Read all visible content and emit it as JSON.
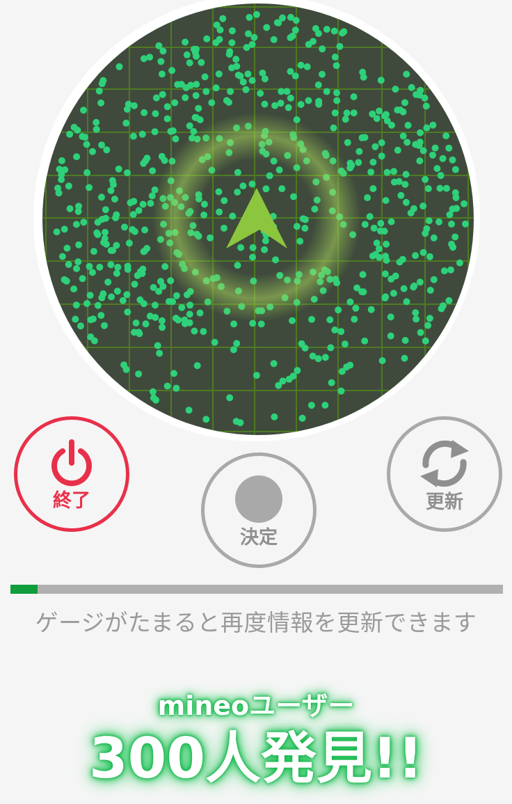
{
  "radar": {
    "background": "#3f4a3c",
    "grid_color": "#4e7a22",
    "dot_color": "#2ed17a",
    "ring_color": "#8bc34a",
    "arrow_color": "#8cc63f"
  },
  "controls": {
    "end": {
      "label": "終了",
      "icon": "power-icon",
      "color": "#e8304a"
    },
    "decide": {
      "label": "決定",
      "icon": "record-icon",
      "color": "#a9a9a9"
    },
    "refresh": {
      "label": "更新",
      "icon": "refresh-icon",
      "color": "#a9a9a9"
    }
  },
  "gauge": {
    "progress": 0.055,
    "hint": "ゲージがたまると再度情報を更新できます",
    "fill_color": "#0f9d3e",
    "track_color": "#b0b0b0"
  },
  "result": {
    "users_label": "mineoユーザー",
    "found_text": "300人発見!!"
  }
}
